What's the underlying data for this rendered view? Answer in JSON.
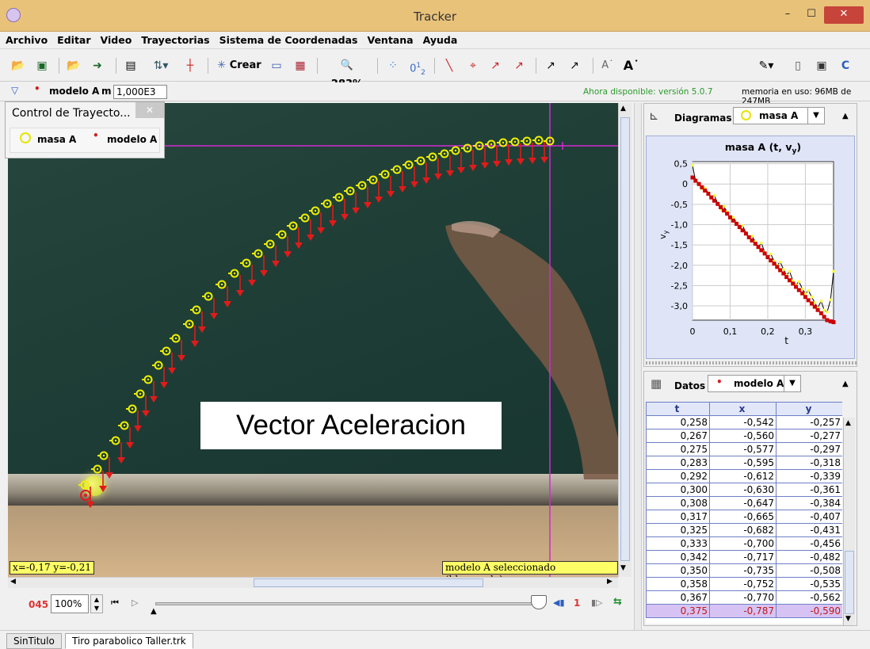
{
  "window": {
    "title": "Tracker",
    "min": "–",
    "max": "☐",
    "close": "✕"
  },
  "menu": [
    "Archivo",
    "Editar",
    "Video",
    "Trayectorias",
    "Sistema de Coordenadas",
    "Ventana",
    "Ayuda"
  ],
  "toolbar": {
    "create_label": "Crear",
    "zoom_label": "283%",
    "clip_label": "0",
    "clip_sub": "1",
    "clip_sub2": "2"
  },
  "trackbar": {
    "track_name": "modelo A",
    "mass_label": "m",
    "mass_value": "1,000E3",
    "update_notice": "Ahora disponible: versión 5.0.7",
    "memory": "memoria en uso: 96MB de 247MB"
  },
  "control_panel": {
    "title": "Control de Trayecto...",
    "close": "✕",
    "tracks": [
      "masa A",
      "modelo A"
    ]
  },
  "video": {
    "caption": "Vector Aceleracion",
    "mouse_readout": "x=-0,17  y=-0,21",
    "selection_status": "modelo A seleccionado (bloqueado)",
    "trajectory": {
      "arrow_length": 28,
      "points": [
        [
          107,
          612
        ],
        [
          123,
          592
        ],
        [
          131,
          575
        ],
        [
          146,
          556
        ],
        [
          157,
          537
        ],
        [
          167,
          516
        ],
        [
          177,
          497
        ],
        [
          187,
          479
        ],
        [
          200,
          461
        ],
        [
          210,
          443
        ],
        [
          222,
          427
        ],
        [
          239,
          409
        ],
        [
          248,
          391
        ],
        [
          263,
          374
        ],
        [
          280,
          359
        ],
        [
          296,
          345
        ],
        [
          311,
          332
        ],
        [
          326,
          320
        ],
        [
          341,
          308
        ],
        [
          356,
          296
        ],
        [
          370,
          285
        ],
        [
          385,
          275
        ],
        [
          398,
          266
        ],
        [
          413,
          257
        ],
        [
          428,
          249
        ],
        [
          442,
          241
        ],
        [
          457,
          234
        ],
        [
          471,
          227
        ],
        [
          486,
          220
        ],
        [
          501,
          214
        ],
        [
          516,
          208
        ],
        [
          531,
          203
        ],
        [
          546,
          198
        ],
        [
          561,
          194
        ],
        [
          575,
          190
        ],
        [
          590,
          187
        ],
        [
          605,
          184
        ],
        [
          620,
          182
        ],
        [
          635,
          180
        ],
        [
          650,
          179
        ],
        [
          665,
          178
        ],
        [
          680,
          177
        ],
        [
          694,
          178
        ]
      ],
      "model_point": [
        108,
        625
      ],
      "axis_origin": [
        694,
        184
      ]
    }
  },
  "player": {
    "frame": "045",
    "zoom": "100%",
    "step": "1"
  },
  "plot": {
    "panel_label": "Diagramas",
    "track_label": "masa A",
    "chart_data": {
      "type": "line",
      "title": "masa A (t, vy)",
      "xlabel": "t",
      "ylabel": "vy",
      "xlim": [
        0,
        0.375
      ],
      "ylim": [
        -3.35,
        0.55
      ],
      "xticks": [
        "0",
        "0,1",
        "0,2",
        "0,3"
      ],
      "xtick_values": [
        0,
        0.1,
        0.2,
        0.3
      ],
      "yticks": [
        "0,5",
        "0",
        "-0,5",
        "-1,0",
        "-1,5",
        "-2,0",
        "-2,5",
        "-3,0"
      ],
      "ytick_values": [
        0.5,
        0,
        -0.5,
        -1.0,
        -1.5,
        -2.0,
        -2.5,
        -3.0
      ],
      "series": [
        {
          "role": "measured",
          "color": "#000000",
          "marker_color": "#ffff33",
          "x": [
            0.0,
            0.008,
            0.017,
            0.025,
            0.033,
            0.042,
            0.05,
            0.058,
            0.067,
            0.075,
            0.083,
            0.092,
            0.1,
            0.108,
            0.117,
            0.125,
            0.133,
            0.142,
            0.15,
            0.158,
            0.167,
            0.175,
            0.183,
            0.192,
            0.2,
            0.208,
            0.217,
            0.225,
            0.233,
            0.242,
            0.25,
            0.258,
            0.267,
            0.275,
            0.283,
            0.292,
            0.3,
            0.308,
            0.317,
            0.325,
            0.333,
            0.342,
            0.35,
            0.358,
            0.367,
            0.375
          ],
          "y": [
            0.46,
            0.08,
            0.02,
            -0.12,
            -0.1,
            -0.22,
            -0.35,
            -0.28,
            -0.48,
            -0.62,
            -0.55,
            -0.68,
            -0.85,
            -0.82,
            -0.95,
            -1.08,
            -1.02,
            -1.2,
            -1.3,
            -1.28,
            -1.42,
            -1.55,
            -1.45,
            -1.68,
            -1.8,
            -1.72,
            -1.9,
            -2.0,
            -1.92,
            -2.1,
            -2.25,
            -2.15,
            -2.38,
            -2.48,
            -2.4,
            -2.58,
            -2.7,
            -2.62,
            -2.78,
            -2.92,
            -3.05,
            -2.88,
            -3.1,
            -3.15,
            -2.85,
            -2.15
          ]
        },
        {
          "role": "model",
          "color": "#cc0000",
          "x": [
            0.0,
            0.008,
            0.017,
            0.025,
            0.033,
            0.042,
            0.05,
            0.058,
            0.067,
            0.075,
            0.083,
            0.092,
            0.1,
            0.108,
            0.117,
            0.125,
            0.133,
            0.142,
            0.15,
            0.158,
            0.167,
            0.175,
            0.183,
            0.192,
            0.2,
            0.208,
            0.217,
            0.225,
            0.233,
            0.242,
            0.25,
            0.258,
            0.267,
            0.275,
            0.283,
            0.292,
            0.3,
            0.308,
            0.317,
            0.325,
            0.333,
            0.342,
            0.35,
            0.358,
            0.367,
            0.375
          ],
          "y": [
            0.16,
            0.08,
            0.0,
            -0.08,
            -0.16,
            -0.24,
            -0.33,
            -0.41,
            -0.49,
            -0.57,
            -0.65,
            -0.73,
            -0.82,
            -0.9,
            -0.98,
            -1.06,
            -1.14,
            -1.22,
            -1.31,
            -1.39,
            -1.47,
            -1.55,
            -1.63,
            -1.71,
            -1.8,
            -1.88,
            -1.96,
            -2.04,
            -2.12,
            -2.2,
            -2.29,
            -2.37,
            -2.45,
            -2.53,
            -2.61,
            -2.69,
            -2.78,
            -2.86,
            -2.94,
            -3.02,
            -3.1,
            -3.18,
            -3.27,
            -3.35,
            -3.38,
            -3.4
          ]
        }
      ]
    }
  },
  "data_panel": {
    "panel_label": "Datos",
    "track_label": "modelo A",
    "columns": [
      "t",
      "x",
      "y"
    ],
    "rows": [
      [
        "0,258",
        "-0,542",
        "-0,257"
      ],
      [
        "0,267",
        "-0,560",
        "-0,277"
      ],
      [
        "0,275",
        "-0,577",
        "-0,297"
      ],
      [
        "0,283",
        "-0,595",
        "-0,318"
      ],
      [
        "0,292",
        "-0,612",
        "-0,339"
      ],
      [
        "0,300",
        "-0,630",
        "-0,361"
      ],
      [
        "0,308",
        "-0,647",
        "-0,384"
      ],
      [
        "0,317",
        "-0,665",
        "-0,407"
      ],
      [
        "0,325",
        "-0,682",
        "-0,431"
      ],
      [
        "0,333",
        "-0,700",
        "-0,456"
      ],
      [
        "0,342",
        "-0,717",
        "-0,482"
      ],
      [
        "0,350",
        "-0,735",
        "-0,508"
      ],
      [
        "0,358",
        "-0,752",
        "-0,535"
      ],
      [
        "0,367",
        "-0,770",
        "-0,562"
      ],
      [
        "0,375",
        "-0,787",
        "-0,590"
      ]
    ]
  },
  "tabs": [
    "SinTitulo",
    "Tiro parabolico Taller.trk"
  ]
}
